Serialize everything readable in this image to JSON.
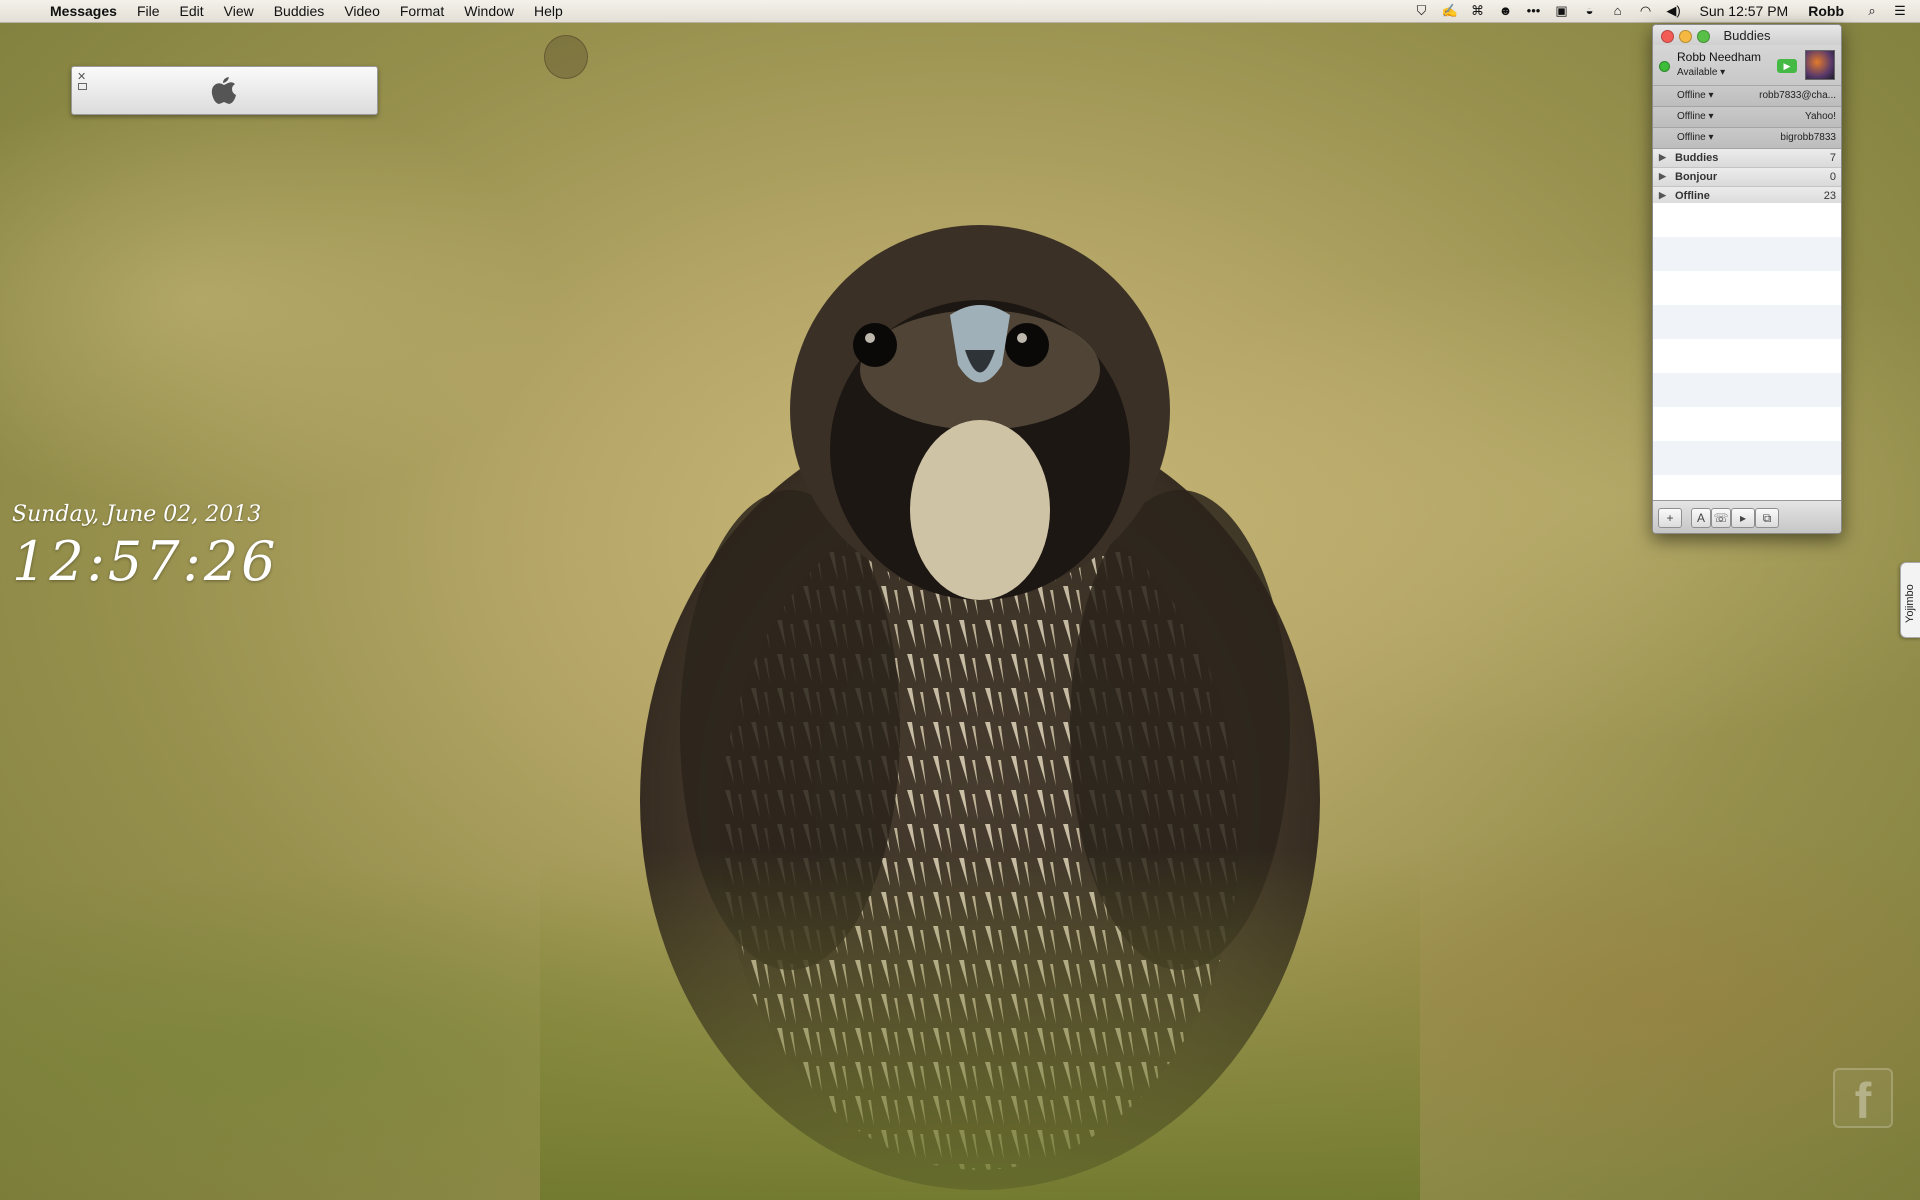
{
  "menubar": {
    "app": "Messages",
    "menus": [
      "File",
      "Edit",
      "View",
      "Buddies",
      "Video",
      "Format",
      "Window",
      "Help"
    ],
    "status_icons": [
      "shield-icon",
      "signature-icon",
      "command-icon",
      "face-icon",
      "ellipsis-icon",
      "display-icon",
      "drive-icon",
      "home-icon",
      "wifi-icon",
      "volume-icon"
    ],
    "clock": "Sun 12:57 PM",
    "user": "Robb"
  },
  "desktop_clock": {
    "date": "Sunday, June 02, 2013",
    "time": "12:57:26"
  },
  "buddies_window": {
    "title": "Buddies",
    "me": {
      "name": "Robb Needham",
      "status": "Available ▾"
    },
    "accounts": [
      {
        "status": "Offline ▾",
        "name": "robb7833@cha..."
      },
      {
        "status": "Offline ▾",
        "name": "Yahoo!"
      },
      {
        "status": "Offline ▾",
        "name": "bigrobb7833"
      }
    ],
    "groups": [
      {
        "label": "Buddies",
        "count": "7"
      },
      {
        "label": "Bonjour",
        "count": "0"
      },
      {
        "label": "Offline",
        "count": "23"
      }
    ],
    "toolbar": {
      "add": "+",
      "font": "A"
    }
  },
  "side_tab": "Yojimbo",
  "colors": {
    "available": "#3dbb3a",
    "close": "#f25c55",
    "minimize": "#f5b942",
    "zoom": "#58c047"
  }
}
